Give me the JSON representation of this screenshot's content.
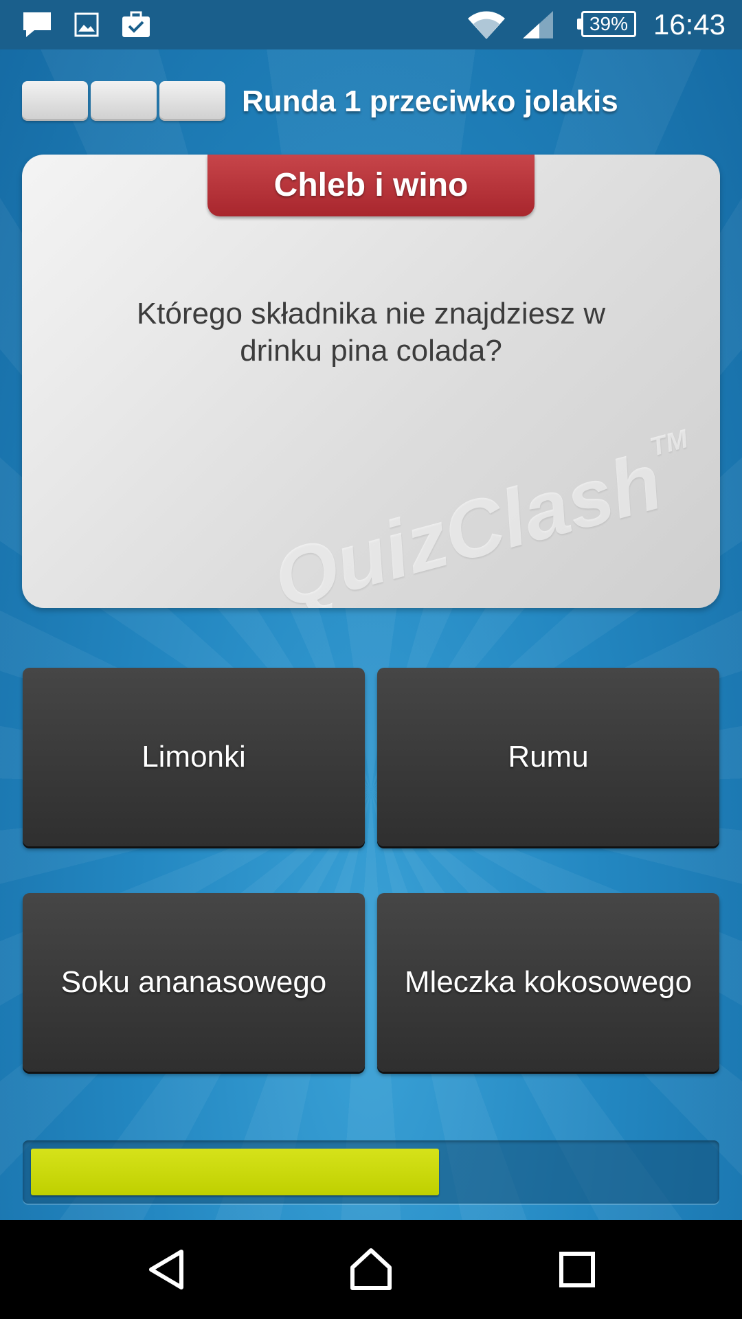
{
  "status_bar": {
    "time": "16:43",
    "battery": "39%",
    "icons": [
      "message-icon",
      "image-icon",
      "briefcase-check-icon",
      "wifi-icon",
      "signal-icon",
      "battery-icon"
    ]
  },
  "header": {
    "round_title": "Runda 1 przeciwko jolakis",
    "round_boxes": 3
  },
  "question_card": {
    "category": "Chleb i wino",
    "question": "Którego składnika nie znajdziesz w drinku pina colada?",
    "watermark": "QuizClash",
    "watermark_tm": "TM"
  },
  "answers": [
    {
      "label": "Limonki"
    },
    {
      "label": "Rumu"
    },
    {
      "label": "Soku ananasowego"
    },
    {
      "label": "Mleczka kokosowego"
    }
  ],
  "timer": {
    "remaining_fraction": 0.6,
    "color": "#c4d600"
  },
  "colors": {
    "status_bar": "#1a5f8c",
    "background": "#1f86bf",
    "category_tab": "#b6333a",
    "answer_button": "#3a3a3a",
    "nav_bar": "#000000"
  },
  "nav_bar": {
    "icons": [
      "back-icon",
      "home-icon",
      "recents-icon"
    ]
  }
}
